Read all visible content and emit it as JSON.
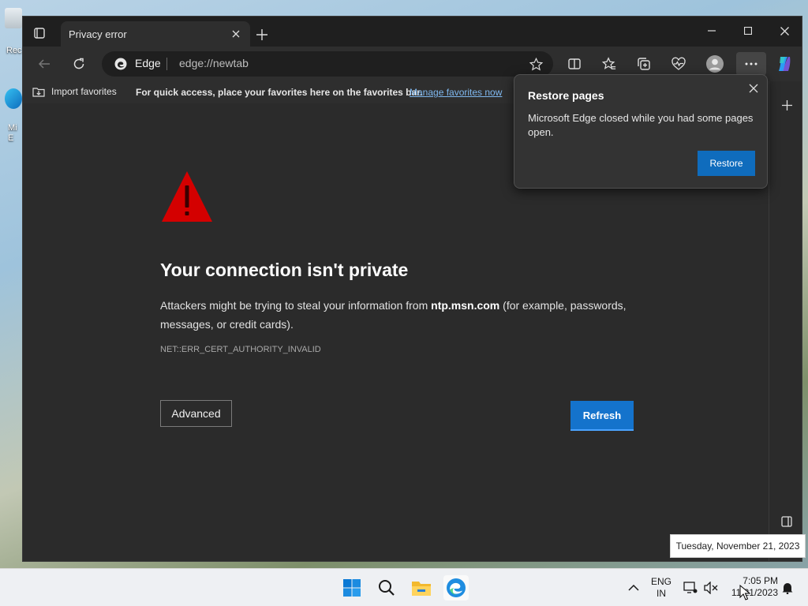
{
  "desktop": {
    "icons": [
      {
        "name": "recycle-bin",
        "label": "Rec"
      },
      {
        "name": "edge-shortcut",
        "label": "Mi E"
      }
    ]
  },
  "browser": {
    "tab": {
      "title": "Privacy error"
    },
    "omnibox": {
      "brand": "Edge",
      "url": "edge://newtab"
    },
    "favorites_bar": {
      "import_label": "Import favorites",
      "hint": "For quick access, place your favorites here on the favorites bar.",
      "manage_link": "Manage favorites now"
    },
    "error_page": {
      "title": "Your connection isn't private",
      "desc_prefix": "Attackers might be trying to steal your information from ",
      "host": "ntp.msn.com",
      "desc_suffix": " (for example, passwords, messages, or credit cards).",
      "error_code": "NET::ERR_CERT_AUTHORITY_INVALID",
      "advanced_label": "Advanced",
      "refresh_label": "Refresh"
    },
    "restore_popup": {
      "title": "Restore pages",
      "message": "Microsoft Edge closed while you had some pages open.",
      "button_label": "Restore"
    }
  },
  "taskbar": {
    "apps": [
      "start",
      "search",
      "file-explorer",
      "edge"
    ],
    "language": {
      "line1": "ENG",
      "line2": "IN"
    },
    "clock": {
      "time": "7:05 PM",
      "date": "11/21/2023"
    },
    "tooltip": "Tuesday, November 21, 2023"
  },
  "colors": {
    "accent": "#1473cc",
    "warning_red": "#d40000",
    "link": "#7fb8ef"
  }
}
